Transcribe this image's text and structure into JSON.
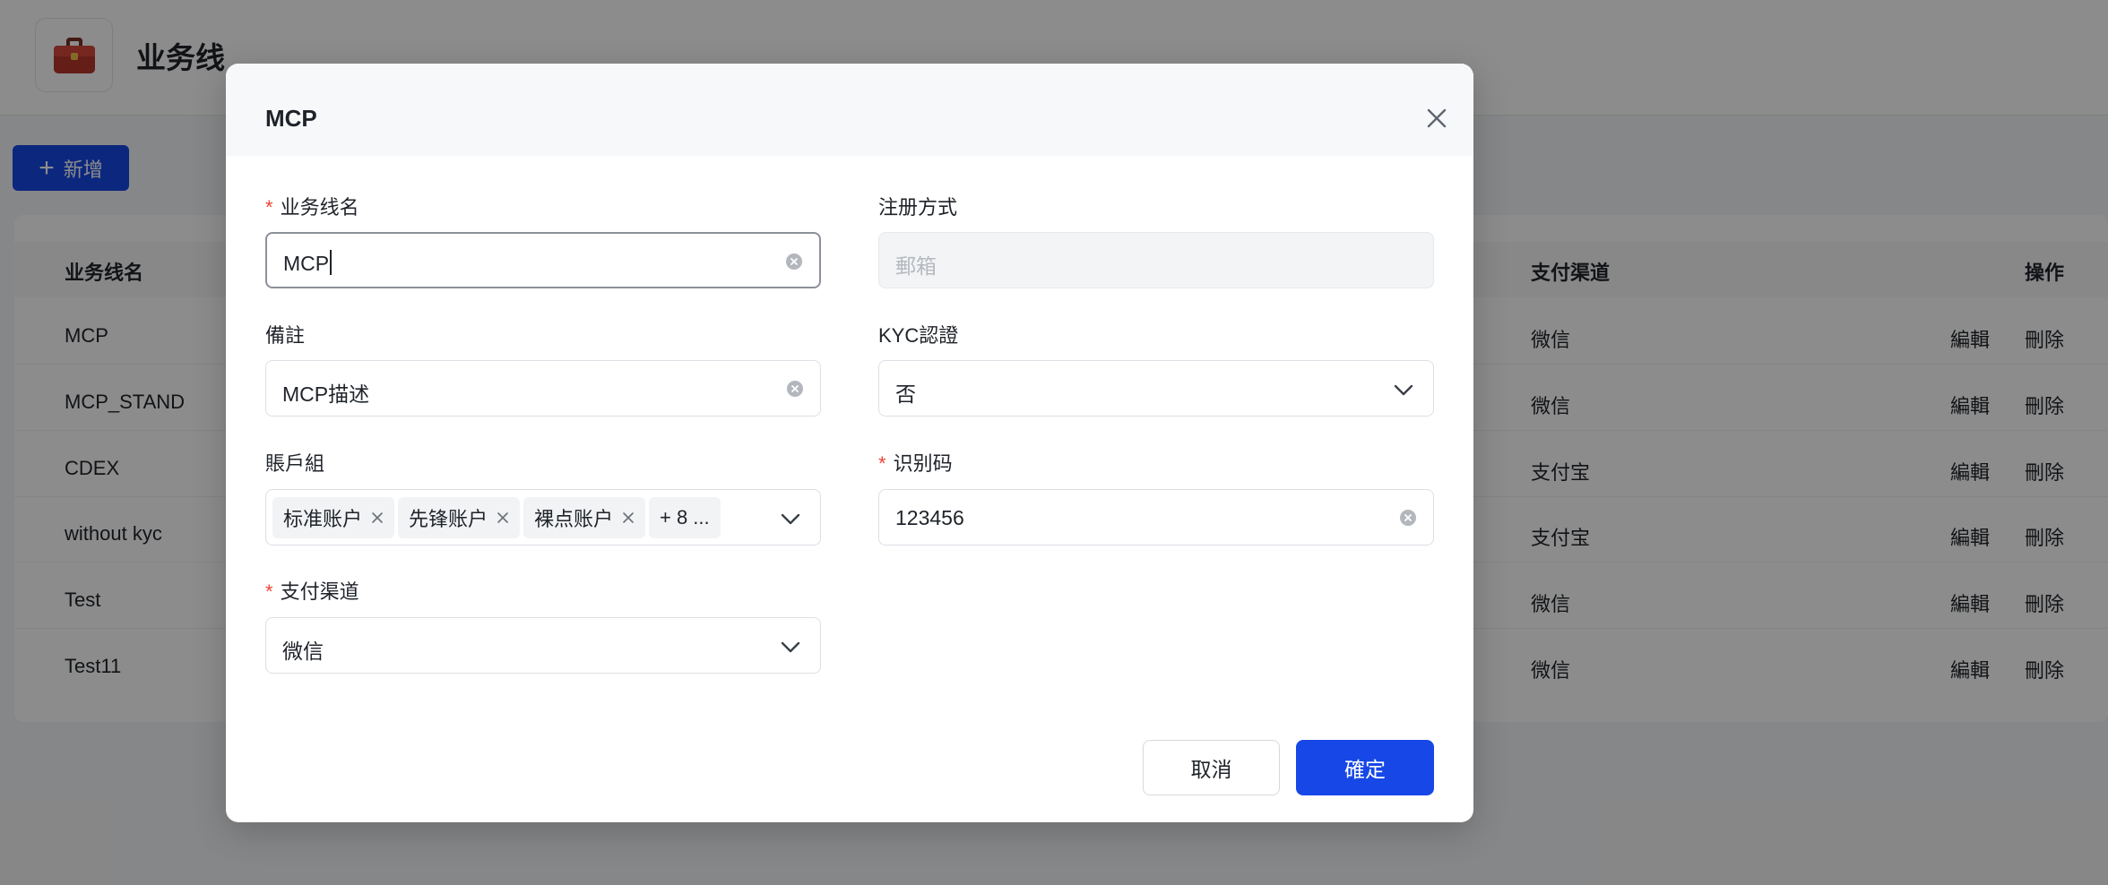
{
  "header": {
    "title": "业务线",
    "logo_icon": "toolbox-icon"
  },
  "toolbar": {
    "add_label": "新增"
  },
  "table": {
    "columns": {
      "name": "业务线名",
      "payment": "支付渠道",
      "actions": "操作"
    },
    "rows": [
      {
        "name": "MCP",
        "payment": "微信",
        "edit": "編輯",
        "delete": "刪除"
      },
      {
        "name": "MCP_STAND",
        "payment": "微信",
        "edit": "編輯",
        "delete": "刪除"
      },
      {
        "name": "CDEX",
        "payment": "支付宝",
        "edit": "編輯",
        "delete": "刪除"
      },
      {
        "name": "without kyc",
        "payment": "支付宝",
        "edit": "編輯",
        "delete": "刪除"
      },
      {
        "name": "Test",
        "payment": "微信",
        "edit": "編輯",
        "delete": "刪除"
      },
      {
        "name": "Test11",
        "payment": "微信",
        "edit": "編輯",
        "delete": "刪除"
      }
    ]
  },
  "modal": {
    "title": "MCP",
    "fields": {
      "line_name": {
        "label": "业务线名",
        "required": "*",
        "value": "MCP"
      },
      "register_method": {
        "label": "注册方式",
        "value": "郵箱"
      },
      "remark": {
        "label": "備註",
        "value": "MCP描述"
      },
      "kyc": {
        "label": "KYC認證",
        "value": "否"
      },
      "account_group": {
        "label": "賬戶組",
        "tags": [
          "标准账户",
          "先锋账户",
          "裸点账户"
        ],
        "more": "+ 8 ..."
      },
      "id_code": {
        "label": "识别码",
        "required": "*",
        "value": "123456"
      },
      "payment": {
        "label": "支付渠道",
        "required": "*",
        "value": "微信"
      }
    },
    "buttons": {
      "cancel": "取消",
      "ok": "確定"
    }
  },
  "colors": {
    "primary": "#1747e6",
    "required": "#f0443a",
    "overlay": "rgba(0,0,0,0.45)"
  }
}
